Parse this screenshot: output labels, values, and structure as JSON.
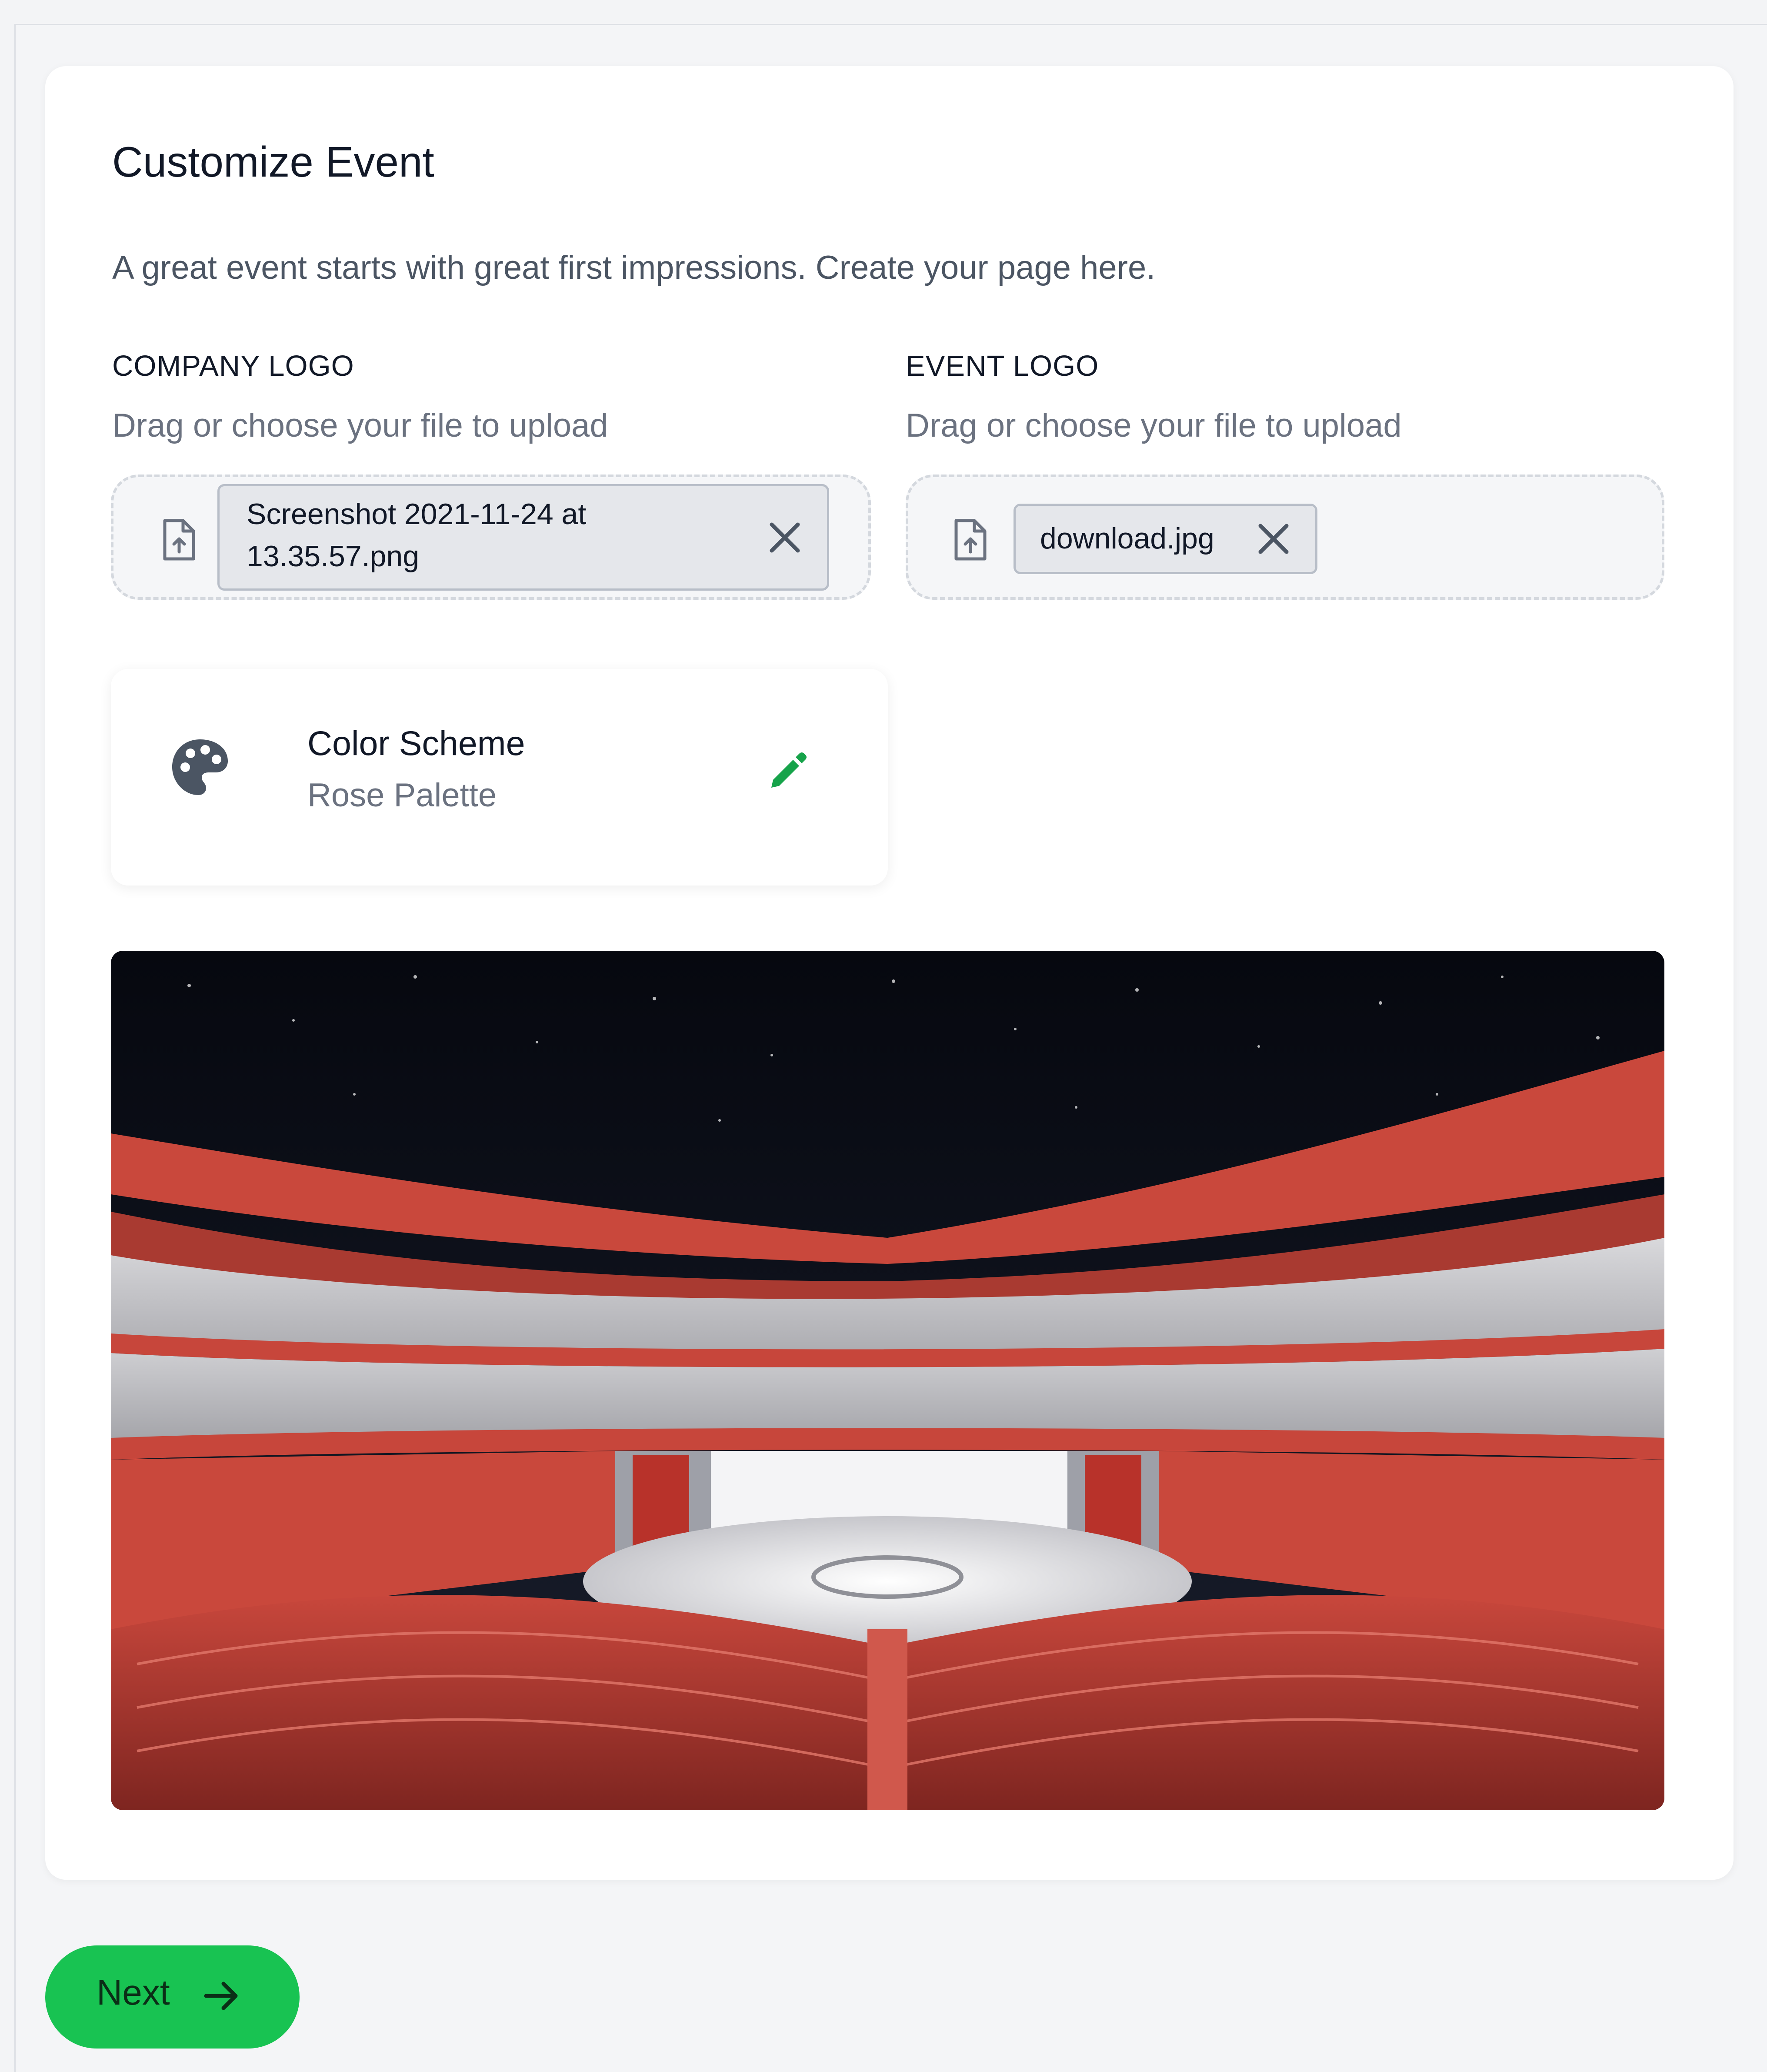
{
  "page": {
    "title": "Customize Event",
    "subtitle": "A great event starts with great first impressions. Create your page here."
  },
  "company_logo": {
    "label": "COMPANY LOGO",
    "hint": "Drag or choose your file to upload",
    "file_name_line1": "Screenshot 2021-11-24 at",
    "file_name_line2": "13.35.57.png"
  },
  "event_logo": {
    "label": "EVENT LOGO",
    "hint": "Drag or choose your file to upload",
    "file_name": "download.jpg"
  },
  "color_scheme": {
    "title": "Color Scheme",
    "value": "Rose Palette"
  },
  "footer": {
    "next_label": "Next"
  },
  "colors": {
    "accent_green": "#18c352",
    "edit_green": "#16a34a",
    "rose": "#d4584a"
  },
  "icons": {
    "file": "file-upload-icon",
    "close": "close-icon",
    "palette": "palette-icon",
    "edit": "pencil-icon",
    "next": "arrow-right-icon"
  }
}
